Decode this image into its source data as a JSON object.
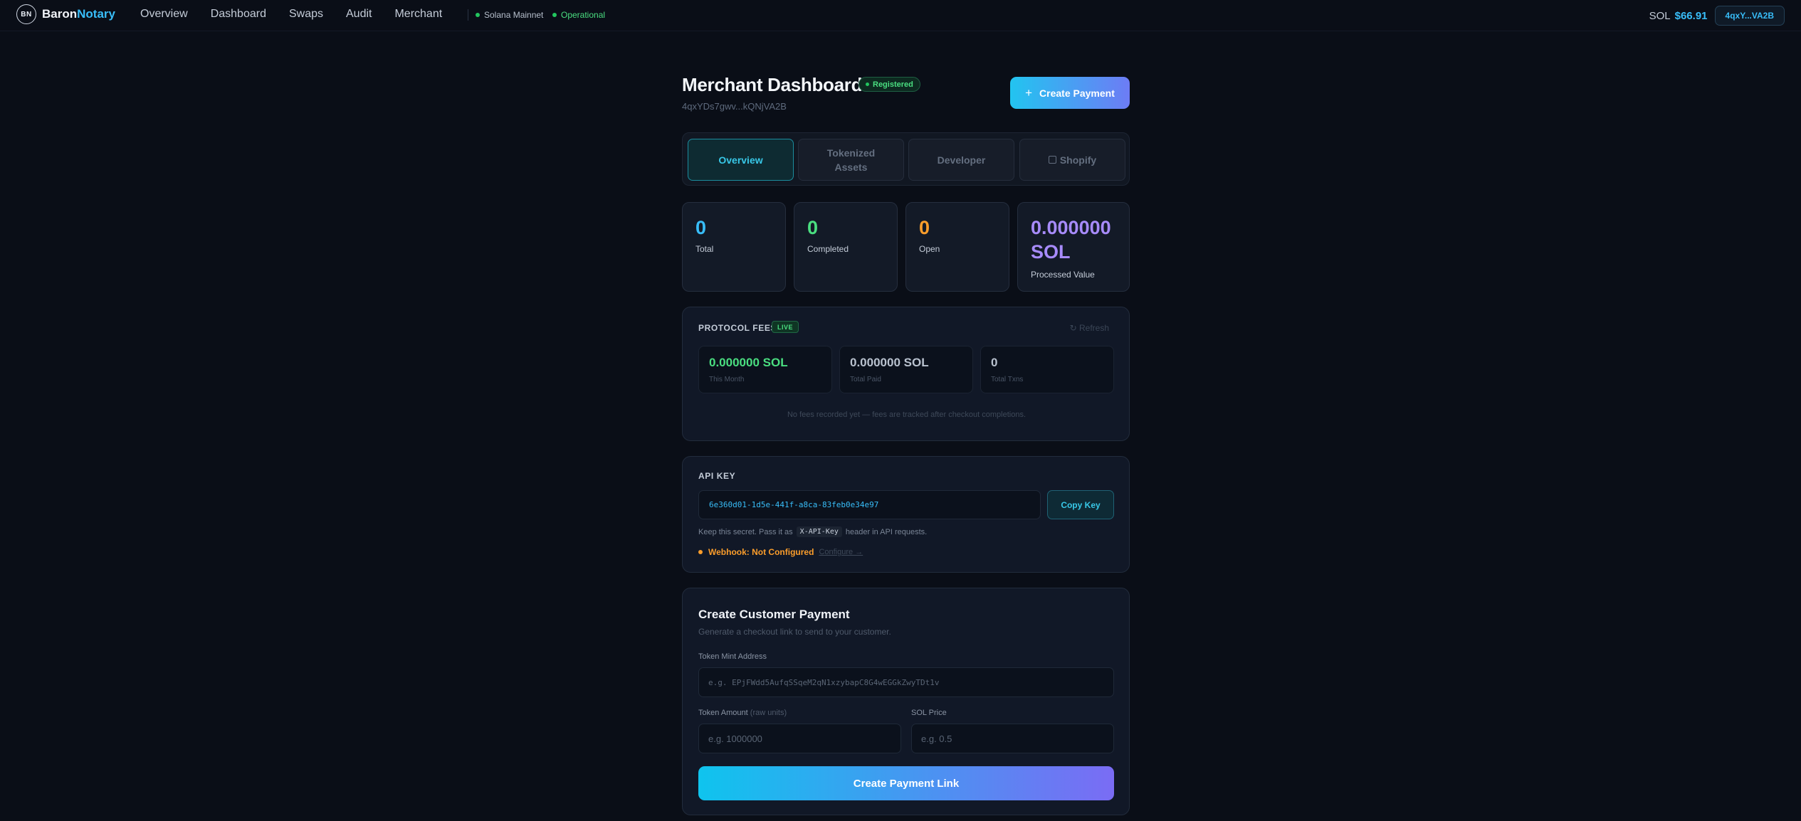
{
  "nav": {
    "logo_initials": "BN",
    "brand_first": "Baron",
    "brand_second": "Notary",
    "links": [
      "Overview",
      "Dashboard",
      "Swaps",
      "Audit",
      "Merchant"
    ],
    "network": "Solana Mainnet",
    "status": "Operational",
    "sol_label": "SOL",
    "sol_balance": "$66.91",
    "wallet": "4qxY...VA2B"
  },
  "header": {
    "title": "Merchant Dashboard",
    "badge": "Registered",
    "address": "4qxYDs7gwv...kQNjVA2B",
    "create_button": "Create Payment"
  },
  "tabs": [
    {
      "label": "Overview"
    },
    {
      "label": "Tokenized Assets"
    },
    {
      "label": "Developer"
    },
    {
      "label": "Shopify"
    }
  ],
  "stats": [
    {
      "value": "0",
      "label": "Total"
    },
    {
      "value": "0",
      "label": "Completed"
    },
    {
      "value": "0",
      "label": "Open"
    },
    {
      "value": "0.000000 SOL",
      "label": "Processed Value"
    }
  ],
  "fees": {
    "title": "PROTOCOL FEES",
    "badge": "LIVE",
    "refresh": "↻ Refresh",
    "cards": [
      {
        "value": "0.000000 SOL",
        "label": "This Month"
      },
      {
        "value": "0.000000 SOL",
        "label": "Total Paid"
      },
      {
        "value": "0",
        "label": "Total Txns"
      }
    ],
    "note": "No fees recorded yet — fees are tracked after checkout completions."
  },
  "api": {
    "title": "API KEY",
    "key": "6e360d01-1d5e-441f-a8ca-83feb0e34e97",
    "copy_button": "Copy Key",
    "hint_before": "Keep this secret. Pass it as",
    "hint_code": "X-API-Key",
    "hint_after": "header in API requests.",
    "webhook_status": "Webhook: Not Configured",
    "webhook_link": "Configure →"
  },
  "payment": {
    "title": "Create Customer Payment",
    "subtitle": "Generate a checkout link to send to your customer.",
    "mint_label": "Token Mint Address",
    "mint_placeholder": "e.g. EPjFWdd5AufqSSqeM2qN1xzybapC8G4wEGGkZwyTDt1v",
    "amount_label": "Token Amount",
    "amount_hint": "(raw units)",
    "amount_placeholder": "e.g. 1000000",
    "price_label": "SOL Price",
    "price_placeholder": "e.g. 0.5",
    "submit": "Create Payment Link"
  }
}
